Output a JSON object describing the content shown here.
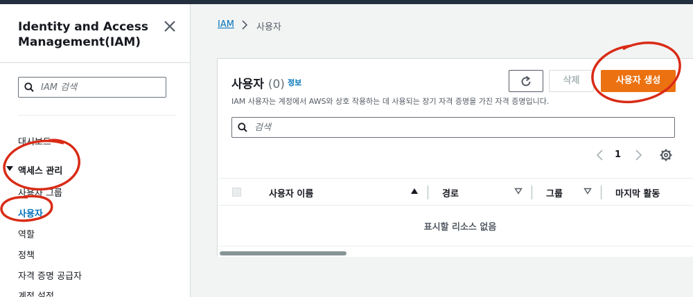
{
  "sidebar": {
    "title": "Identity and Access Management(IAM)",
    "search_placeholder": "IAM 검색",
    "items": [
      {
        "label": "대시보드"
      },
      {
        "label": "액세스 관리"
      },
      {
        "label": "사용자 그룹"
      },
      {
        "label": "사용자"
      },
      {
        "label": "역할"
      },
      {
        "label": "정책"
      },
      {
        "label": "자격 증명 공급자"
      },
      {
        "label": "계정 설정"
      }
    ]
  },
  "breadcrumb": {
    "root": "IAM",
    "current": "사용자"
  },
  "panel": {
    "title": "사용자",
    "count": "(0)",
    "info_link": "정보",
    "description": "IAM 사용자는 계정에서 AWS와 상호 작용하는 데 사용되는 장기 자격 증명을 가진 자격 증명입니다.",
    "delete_label": "삭제",
    "create_label": "사용자 생성",
    "search_placeholder": "검색",
    "page": "1",
    "columns": [
      "사용자 이름",
      "경로",
      "그룹",
      "마지막 활동"
    ],
    "empty_text": "표시할 리소스 없음"
  },
  "colors": {
    "accent": "#0073bb",
    "primary_button": "#ec7211",
    "annotation": "#d92b16"
  },
  "icons": [
    "close-icon",
    "search-icon",
    "chevron-right-icon",
    "refresh-icon",
    "chevron-left-icon",
    "gear-icon",
    "sort-up-icon",
    "sort-down-icon",
    "caret-down-icon"
  ]
}
